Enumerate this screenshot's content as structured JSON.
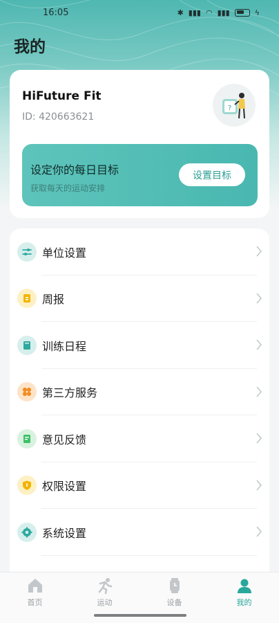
{
  "status_bar": {
    "time": "16:05",
    "signal_text": "⫶ ▴ ▮▮"
  },
  "page": {
    "title": "我的"
  },
  "profile": {
    "name": "HiFuture Fit",
    "id_text": "ID: 420663621"
  },
  "goal": {
    "title": "设定你的每日目标",
    "subtitle": "获取每天的运动安排",
    "button_label": "设置目标"
  },
  "menu": {
    "items": [
      {
        "label": "单位设置",
        "icon": "sliders-icon",
        "color": "#2fa9a0",
        "bg": "#d6efec"
      },
      {
        "label": "周报",
        "icon": "report-icon",
        "color": "#f3b400",
        "bg": "#fdf0c4"
      },
      {
        "label": "训练日程",
        "icon": "book-icon",
        "color": "#2fa9a0",
        "bg": "#d6efec"
      },
      {
        "label": "第三方服务",
        "icon": "grid-icon",
        "color": "#f28a1c",
        "bg": "#fde3c8"
      },
      {
        "label": "意见反馈",
        "icon": "feedback-icon",
        "color": "#3fbf68",
        "bg": "#d8f2df"
      },
      {
        "label": "权限设置",
        "icon": "shield-icon",
        "color": "#f3b400",
        "bg": "#fdf0c4"
      },
      {
        "label": "系统设置",
        "icon": "gear-icon",
        "color": "#2fa9a0",
        "bg": "#d6efec"
      }
    ]
  },
  "nav": {
    "items": [
      {
        "label": "首页",
        "icon": "home-icon",
        "active": false
      },
      {
        "label": "运动",
        "icon": "run-icon",
        "active": false
      },
      {
        "label": "设备",
        "icon": "watch-icon",
        "active": false
      },
      {
        "label": "我的",
        "icon": "profile-icon",
        "active": true
      }
    ]
  },
  "colors": {
    "accent": "#2aa79d",
    "inactive": "#9aa0a4",
    "banner": "#4fb8b0"
  }
}
